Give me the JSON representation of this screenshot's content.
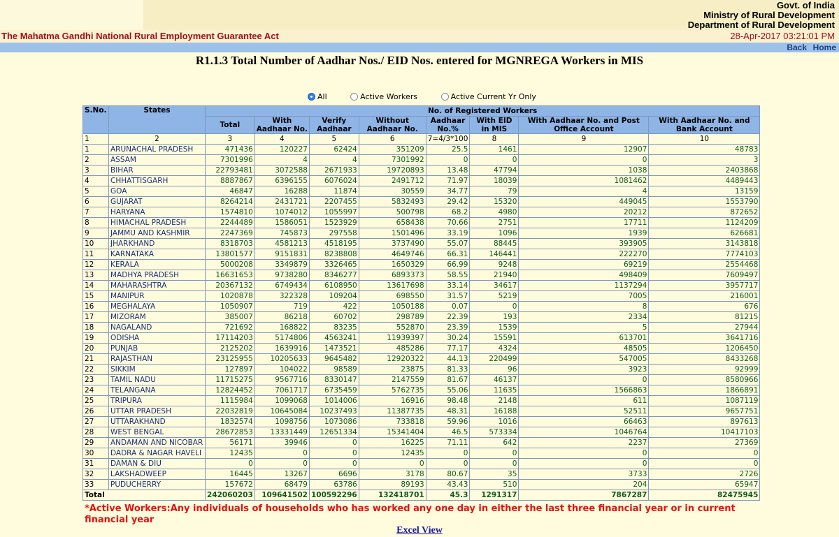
{
  "header": {
    "gov": "Govt. of India",
    "ministry": "Ministry of Rural Development",
    "department": "Department of Rural Development",
    "act_title": "The Mahatma Gandhi National Rural Employment Guarantee Act",
    "datetime": "28-Apr-2017 03:21:01 PM"
  },
  "nav": {
    "back": "Back",
    "home": "Home"
  },
  "report_title": "R1.1.3 Total Number of Aadhar Nos./ EID Nos. entered for MGNREGA Workers in MIS",
  "filters": {
    "all": "All",
    "active_workers": "Active Workers",
    "active_current_yr": "Active Current Yr Only",
    "selected": "All"
  },
  "table": {
    "headers": {
      "sno": "S.No.",
      "states": "States",
      "group": "No. of Registered Workers",
      "total": "Total",
      "with_aadhaar_1": "With",
      "with_aadhaar_2": "Aadhaar No.",
      "verify_1": "Verify",
      "verify_2": "Aadhaar",
      "without_1": "Without",
      "without_2": "Aadhaar No.",
      "pct_1": "Aadhaar",
      "pct_2": "No.%",
      "eid_1": "With EID",
      "eid_2": "in MIS",
      "post_1": "With Aadhaar No. and Post",
      "post_2": "Office Account",
      "bank_1": "With Aadhaar No. and",
      "bank_2": "Bank Account"
    },
    "column_numbers": [
      "1",
      "2",
      "3",
      "4",
      "5",
      "6",
      "7=4/3*100",
      "8",
      "9",
      "10"
    ],
    "rows": [
      [
        "1",
        "ARUNACHAL PRADESH",
        "471436",
        "120227",
        "62424",
        "351209",
        "25.5",
        "1461",
        "12907",
        "48783"
      ],
      [
        "2",
        "ASSAM",
        "7301996",
        "4",
        "4",
        "7301992",
        "0",
        "0",
        "0",
        "3"
      ],
      [
        "3",
        "BIHAR",
        "22793481",
        "3072588",
        "2671933",
        "19720893",
        "13.48",
        "47794",
        "1038",
        "2403868"
      ],
      [
        "4",
        "CHHATTISGARH",
        "8887867",
        "6396155",
        "6076024",
        "2491712",
        "71.97",
        "18039",
        "1081462",
        "4489443"
      ],
      [
        "5",
        "GOA",
        "46847",
        "16288",
        "11874",
        "30559",
        "34.77",
        "79",
        "4",
        "13159"
      ],
      [
        "6",
        "GUJARAT",
        "8264214",
        "2431721",
        "2207455",
        "5832493",
        "29.42",
        "15320",
        "449045",
        "1553790"
      ],
      [
        "7",
        "HARYANA",
        "1574810",
        "1074012",
        "1055997",
        "500798",
        "68.2",
        "4980",
        "20212",
        "872652"
      ],
      [
        "8",
        "HIMACHAL PRADESH",
        "2244489",
        "1586051",
        "1523929",
        "658438",
        "70.66",
        "2751",
        "17711",
        "1124209"
      ],
      [
        "9",
        "JAMMU AND KASHMIR",
        "2247369",
        "745873",
        "297558",
        "1501496",
        "33.19",
        "1096",
        "1939",
        "626681"
      ],
      [
        "10",
        "JHARKHAND",
        "8318703",
        "4581213",
        "4518195",
        "3737490",
        "55.07",
        "88445",
        "393905",
        "3143818"
      ],
      [
        "11",
        "KARNATAKA",
        "13801577",
        "9151831",
        "8238808",
        "4649746",
        "66.31",
        "146441",
        "222270",
        "7774103"
      ],
      [
        "12",
        "KERALA",
        "5000208",
        "3349879",
        "3326465",
        "1650329",
        "66.99",
        "9248",
        "69219",
        "2554468"
      ],
      [
        "13",
        "MADHYA PRADESH",
        "16631653",
        "9738280",
        "8346277",
        "6893373",
        "58.55",
        "21940",
        "498409",
        "7609497"
      ],
      [
        "14",
        "MAHARASHTRA",
        "20367132",
        "6749434",
        "6108950",
        "13617698",
        "33.14",
        "34617",
        "1137294",
        "3957717"
      ],
      [
        "15",
        "MANIPUR",
        "1020878",
        "322328",
        "109204",
        "698550",
        "31.57",
        "5219",
        "7005",
        "216001"
      ],
      [
        "16",
        "MEGHALAYA",
        "1050907",
        "719",
        "422",
        "1050188",
        "0.07",
        "0",
        "8",
        "676"
      ],
      [
        "17",
        "MIZORAM",
        "385007",
        "86218",
        "60702",
        "298789",
        "22.39",
        "193",
        "2334",
        "81215"
      ],
      [
        "18",
        "NAGALAND",
        "721692",
        "168822",
        "83235",
        "552870",
        "23.39",
        "1539",
        "5",
        "27944"
      ],
      [
        "19",
        "ODISHA",
        "17114203",
        "5174806",
        "4563241",
        "11939397",
        "30.24",
        "15591",
        "613701",
        "3641716"
      ],
      [
        "20",
        "PUNJAB",
        "2125202",
        "1639916",
        "1473521",
        "485286",
        "77.17",
        "4324",
        "48505",
        "1206450"
      ],
      [
        "21",
        "RAJASTHAN",
        "23125955",
        "10205633",
        "9645482",
        "12920322",
        "44.13",
        "220499",
        "547005",
        "8433268"
      ],
      [
        "22",
        "SIKKIM",
        "127897",
        "104022",
        "98589",
        "23875",
        "81.33",
        "96",
        "3923",
        "92999"
      ],
      [
        "23",
        "TAMIL NADU",
        "11715275",
        "9567716",
        "8330147",
        "2147559",
        "81.67",
        "46137",
        "0",
        "8580966"
      ],
      [
        "24",
        "TELANGANA",
        "12824452",
        "7061717",
        "6735459",
        "5762735",
        "55.06",
        "11635",
        "1566863",
        "1866891"
      ],
      [
        "25",
        "TRIPURA",
        "1115984",
        "1099068",
        "1014006",
        "16916",
        "98.48",
        "2148",
        "611",
        "1087119"
      ],
      [
        "26",
        "UTTAR PRADESH",
        "22032819",
        "10645084",
        "10237493",
        "11387735",
        "48.31",
        "16188",
        "52511",
        "9657751"
      ],
      [
        "27",
        "UTTARAKHAND",
        "1832574",
        "1098756",
        "1073086",
        "733818",
        "59.96",
        "1016",
        "66463",
        "897613"
      ],
      [
        "28",
        "WEST BENGAL",
        "28672853",
        "13331449",
        "12651334",
        "15341404",
        "46.5",
        "573334",
        "1046764",
        "10417103"
      ],
      [
        "29",
        "ANDAMAN AND NICOBAR",
        "56171",
        "39946",
        "0",
        "16225",
        "71.11",
        "642",
        "2237",
        "27369"
      ],
      [
        "30",
        "DADRA & NAGAR HAVELI",
        "12435",
        "0",
        "0",
        "12435",
        "0",
        "0",
        "0",
        "0"
      ],
      [
        "31",
        "DAMAN & DIU",
        "0",
        "0",
        "0",
        "0",
        "0",
        "0",
        "0",
        "0"
      ],
      [
        "32",
        "LAKSHADWEEP",
        "16445",
        "13267",
        "6696",
        "3178",
        "80.67",
        "35",
        "3733",
        "2726"
      ],
      [
        "33",
        "PUDUCHERRY",
        "157672",
        "68479",
        "63786",
        "89193",
        "43.43",
        "510",
        "204",
        "65947"
      ]
    ],
    "total": [
      "Total",
      "242060203",
      "109641502",
      "100592296",
      "132418701",
      "45.3",
      "1291317",
      "7867287",
      "82475945"
    ]
  },
  "note": "*Active Workers:Any individuals of households who has worked any one day in either the last three financial year or in current financial year",
  "excel_link": "Excel View"
}
